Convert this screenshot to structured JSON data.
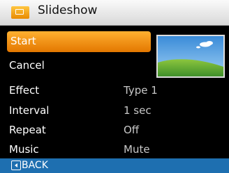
{
  "header": {
    "title": "Slideshow",
    "icon": "slideshow-icon"
  },
  "menu": {
    "start_label": "Start",
    "cancel_label": "Cancel",
    "settings": [
      {
        "label": "Effect",
        "value": "Type 1"
      },
      {
        "label": "Interval",
        "value": "1 sec"
      },
      {
        "label": "Repeat",
        "value": "Off"
      },
      {
        "label": "Music",
        "value": "Mute"
      }
    ]
  },
  "preview": {
    "description_icon": "landscape-preview-image"
  },
  "footer": {
    "back_label": "BACK",
    "back_icon": "left-arrow-key-icon"
  },
  "colors": {
    "accent": "#f08c10",
    "header_bg": "#ececec",
    "footer_bg": "#1e6fb0",
    "background": "#000000"
  }
}
